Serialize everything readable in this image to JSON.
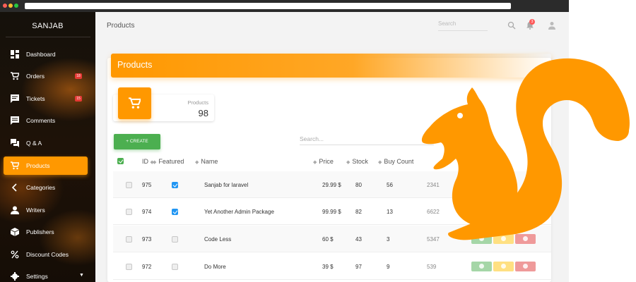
{
  "app": {
    "brand": "SANJAB",
    "page_title": "Products",
    "top_search_placeholder": "Search",
    "notification_count": "3"
  },
  "sidebar": {
    "items": [
      {
        "label": "Dashboard"
      },
      {
        "label": "Orders",
        "badge": "18"
      },
      {
        "label": "Tickets",
        "badge": "15"
      },
      {
        "label": "Comments"
      },
      {
        "label": "Q & A"
      },
      {
        "label": "Products"
      },
      {
        "label": "Categories"
      },
      {
        "label": "Writers"
      },
      {
        "label": "Publishers"
      },
      {
        "label": "Discount Codes"
      },
      {
        "label": "Settings"
      }
    ],
    "active": "Products"
  },
  "card": {
    "title": "Products",
    "stat_label": "Products",
    "stat_value": "98",
    "create_label": "+ CREATE",
    "search_placeholder": "Search..."
  },
  "table": {
    "headers": [
      "ID",
      "Featured",
      "Name",
      "Price",
      "Stock",
      "Buy Count"
    ],
    "rows": [
      {
        "id": "975",
        "featured": true,
        "name": "Sanjab for laravel",
        "price": "29.99 $",
        "stock": "80",
        "buy_count": "56",
        "extra": "2341"
      },
      {
        "id": "974",
        "featured": true,
        "name": "Yet Another Admin Package",
        "price": "99.99 $",
        "stock": "82",
        "buy_count": "13",
        "extra": "6622"
      },
      {
        "id": "973",
        "featured": false,
        "name": "Code Less",
        "price": "60 $",
        "stock": "43",
        "buy_count": "3",
        "extra": "5347"
      },
      {
        "id": "972",
        "featured": false,
        "name": "Do More",
        "price": "39 $",
        "stock": "97",
        "buy_count": "9",
        "extra": "539"
      }
    ]
  },
  "colors": {
    "accent": "#ff9800",
    "success": "#4caf50",
    "checkbox": "#2196f3",
    "badge": "#e53935"
  }
}
